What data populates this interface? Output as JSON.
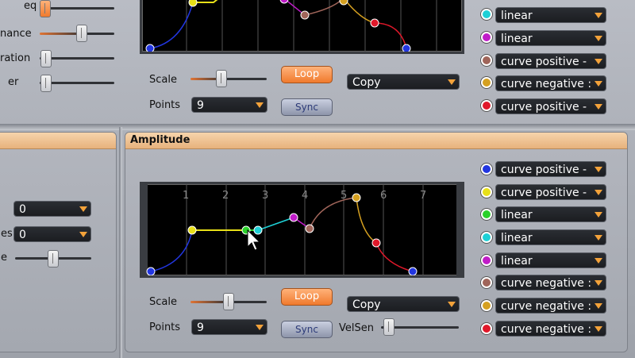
{
  "top": {
    "left_labels": [
      "eq",
      "nance",
      "ration",
      "er"
    ],
    "scale_label": "Scale",
    "points_label": "Points",
    "points_value": "9",
    "loop_label": "Loop",
    "sync_label": "Sync",
    "copy_value": "Copy",
    "curves": [
      {
        "color": "#1ed0d6",
        "label": "linear"
      },
      {
        "color": "#c01cc8",
        "label": "linear"
      },
      {
        "color": "#a0655a",
        "label": "curve positive -"
      },
      {
        "color": "#d5a020",
        "label": "curve negative :"
      },
      {
        "color": "#e0182a",
        "label": "curve positive -"
      }
    ]
  },
  "left_panel": {
    "labels": [
      "es",
      "e"
    ],
    "dd1": "0",
    "dd2": "0"
  },
  "amplitude": {
    "title": "Amplitude",
    "scale_label": "Scale",
    "points_label": "Points",
    "points_value": "9",
    "loop_label": "Loop",
    "sync_label": "Sync",
    "velsen_label": "VelSen",
    "copy_value": "Copy",
    "grid_numbers": [
      "1",
      "2",
      "3",
      "4",
      "5",
      "6",
      "7"
    ],
    "curves": [
      {
        "color": "#2236e0",
        "label": "curve positive -"
      },
      {
        "color": "#e8e018",
        "label": "curve positive -"
      },
      {
        "color": "#2ad12a",
        "label": "linear"
      },
      {
        "color": "#1ed0d6",
        "label": "linear"
      },
      {
        "color": "#c01cc8",
        "label": "linear"
      },
      {
        "color": "#a0655a",
        "label": "curve negative :"
      },
      {
        "color": "#d5a020",
        "label": "curve negative :"
      },
      {
        "color": "#e0182a",
        "label": "curve negative :"
      }
    ]
  }
}
